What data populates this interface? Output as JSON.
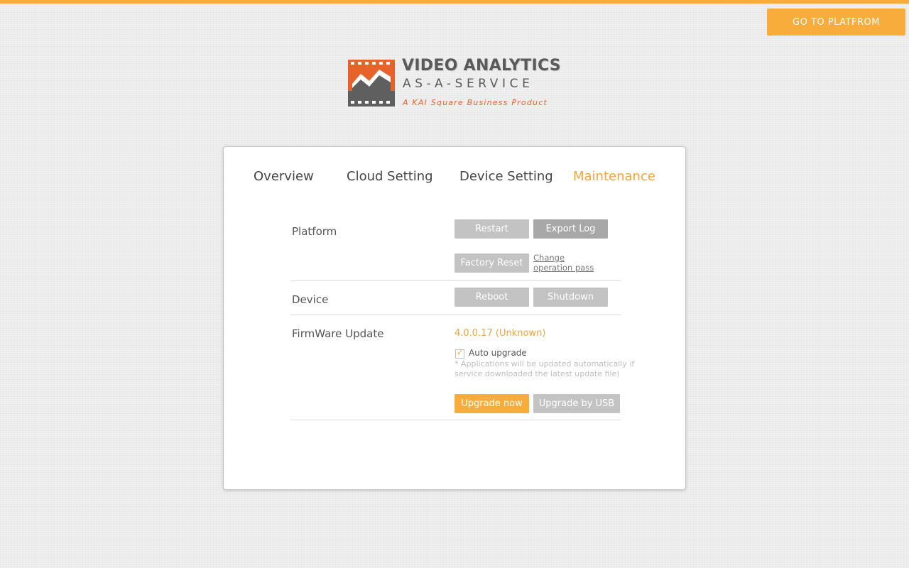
{
  "header": {
    "platform_button": "GO TO PLATFROM"
  },
  "logo": {
    "title": "VIDEO ANALYTICS",
    "subtitle": "AS-A-SERVICE",
    "tagline": "A KAI Square Business Product",
    "icon": "film-chart-icon"
  },
  "tabs": [
    {
      "label": "Overview",
      "active": false
    },
    {
      "label": "Cloud Setting",
      "active": false
    },
    {
      "label": "Device Setting",
      "active": false
    },
    {
      "label": "Maintenance",
      "active": true
    }
  ],
  "maintenance": {
    "platform": {
      "label": "Platform",
      "restart": "Restart",
      "export_log": "Export Log",
      "factory_reset": "Factory Reset",
      "change_pass": "Change operation pass"
    },
    "device": {
      "label": "Device",
      "reboot": "Reboot",
      "shutdown": "Shutdown"
    },
    "firmware": {
      "label": "FirmWare Update",
      "version": "4.0.0.17 (Unknown)",
      "auto_upgrade_label": "Auto upgrade",
      "auto_upgrade_checked": true,
      "note": "* Applications will be updated automatically if service downloaded the latest update file)",
      "upgrade_now": "Upgrade now",
      "upgrade_usb": "Upgrade by USB"
    }
  },
  "colors": {
    "accent": "#f7ac3c",
    "logo_orange": "#e8632a",
    "button_gray": "#c3c3c3"
  }
}
